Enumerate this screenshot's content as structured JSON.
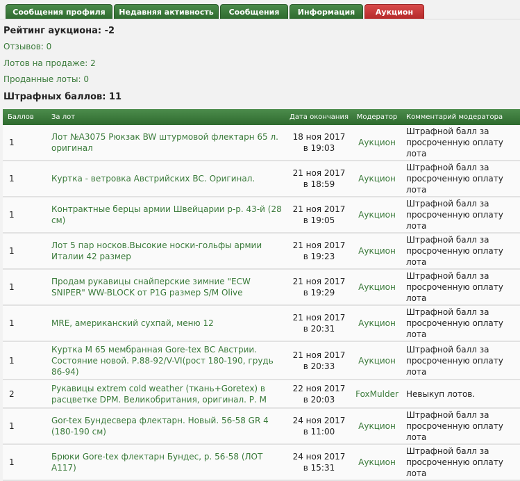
{
  "tabs": [
    {
      "label": "Сообщения профиля",
      "active": false
    },
    {
      "label": "Недавняя активность",
      "active": false
    },
    {
      "label": "Сообщения",
      "active": false
    },
    {
      "label": "Информация",
      "active": false
    },
    {
      "label": "Аукцион",
      "active": true
    }
  ],
  "stats": {
    "rating": "Рейтинг аукциона: -2",
    "reviews": "Отзывов: 0",
    "on_sale": "Лотов на продаже: 2",
    "sold": "Проданные лоты: 0",
    "penalty": "Штрафных баллов: 11"
  },
  "table": {
    "headers": [
      "Баллов",
      "За лот",
      "Дата окончания",
      "Модератор",
      "Комментарий модератора"
    ],
    "rows": [
      {
        "score": "1",
        "lot": "Лот №А3075 Рюкзак BW штурмовой флектарн 65 л. оригинал",
        "date1": "18 ноя 2017",
        "date2": "в 19:03",
        "moderator": "Аукцион",
        "comment": "Штрафной балл за просроченную оплату лота"
      },
      {
        "score": "1",
        "lot": "Куртка - ветровка Австрийских ВС. Оригинал.",
        "date1": "21 ноя 2017",
        "date2": "в 18:59",
        "moderator": "Аукцион",
        "comment": "Штрафной балл за просроченную оплату лота"
      },
      {
        "score": "1",
        "lot": "Контрактные берцы армии Швейцарии р-р. 43-й (28 см)",
        "date1": "21 ноя 2017",
        "date2": "в 19:05",
        "moderator": "Аукцион",
        "comment": "Штрафной балл за просроченную оплату лота"
      },
      {
        "score": "1",
        "lot": "Лот 5 пар носков.Высокие носки-гольфы армии Италии 42 размер",
        "date1": "21 ноя 2017",
        "date2": "в 19:23",
        "moderator": "Аукцион",
        "comment": "Штрафной балл за просроченную оплату лота"
      },
      {
        "score": "1",
        "lot": "Продам рукавицы снайперские зимние \"ECW SNIPER\" WW-BLOCK от P1G размер S/M Olive",
        "date1": "21 ноя 2017",
        "date2": "в 19:29",
        "moderator": "Аукцион",
        "comment": "Штрафной балл за просроченную оплату лота"
      },
      {
        "score": "1",
        "lot": "MRE, американский сухпай, меню 12",
        "date1": "21 ноя 2017",
        "date2": "в 20:31",
        "moderator": "Аукцион",
        "comment": "Штрафной балл за просроченную оплату лота"
      },
      {
        "score": "1",
        "lot": "Куртка М 65 мембранная Gore-tex ВС Австрии. Состояние новой. Р.88-92/V-VI(рост 180-190, грудь 86-94)",
        "date1": "21 ноя 2017",
        "date2": "в 20:33",
        "moderator": "Аукцион",
        "comment": "Штрафной балл за просроченную оплату лота"
      },
      {
        "score": "2",
        "lot": "Рукавицы extrem cold weather (ткань+Goretex) в расцветке DPM. Великобритания, оригинал. Р. М",
        "date1": "22 ноя 2017",
        "date2": "в 20:03",
        "moderator": "FoxMulder",
        "comment": "Невыкуп лотов."
      },
      {
        "score": "1",
        "lot": "Gor-tex Бундесвера флектарн. Новый. 56-58 GR 4 (180-190 см)",
        "date1": "24 ноя 2017",
        "date2": "в 11:00",
        "moderator": "Аукцион",
        "comment": "Штрафной балл за просроченную оплату лота"
      },
      {
        "score": "1",
        "lot": "Брюки Gore-tex флектарн Бундес, р. 56-58 (ЛОТ А117)",
        "date1": "24 ноя 2017",
        "date2": "в 15:31",
        "moderator": "Аукцион",
        "comment": "Штрафной балл за просроченную оплату лота"
      }
    ]
  }
}
